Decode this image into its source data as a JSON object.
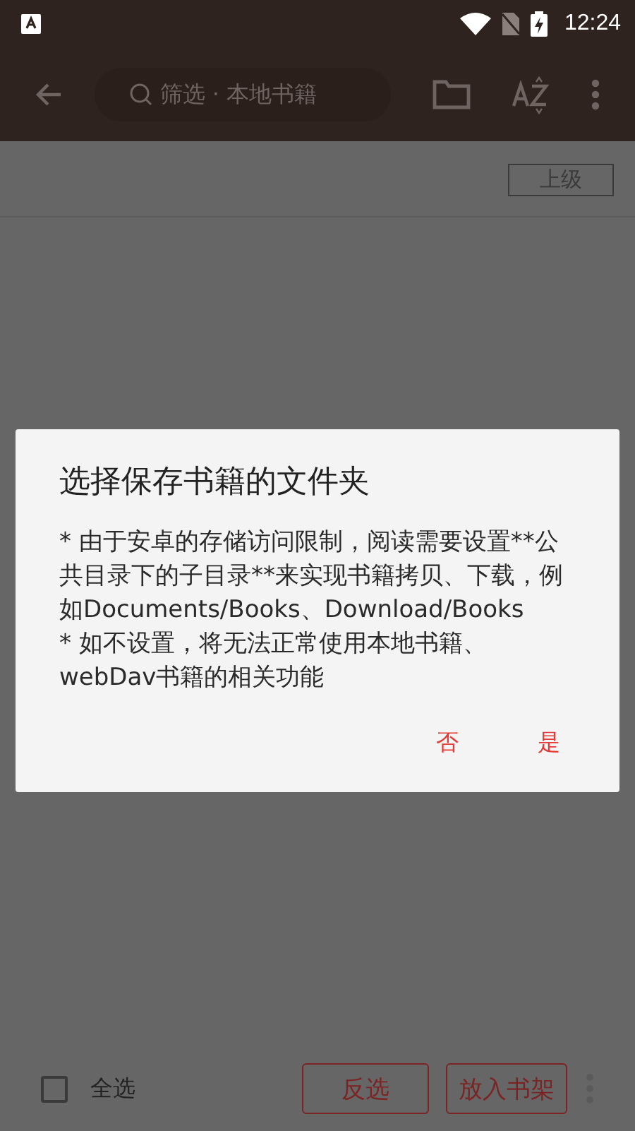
{
  "status_bar": {
    "time": "12:24"
  },
  "toolbar": {
    "search": {
      "placeholder": "筛选 · 本地书籍"
    }
  },
  "path_bar": {
    "up_button": "上级"
  },
  "dialog": {
    "title": "选择保存书籍的文件夹",
    "paragraphs": [
      "* 由于安卓的存储访问限制，阅读需要设置**公共目录下的子目录**来实现书籍拷贝、下载，例如Documents/Books、Download/Books",
      "* 如不设置，将无法正常使用本地书籍、webDav书籍的相关功能"
    ],
    "buttons": [
      "否",
      "是"
    ]
  },
  "bottom_bar": {
    "select_all": {
      "label": "全选",
      "checked": false
    },
    "buttons": [
      "反选",
      "放入书架"
    ]
  }
}
